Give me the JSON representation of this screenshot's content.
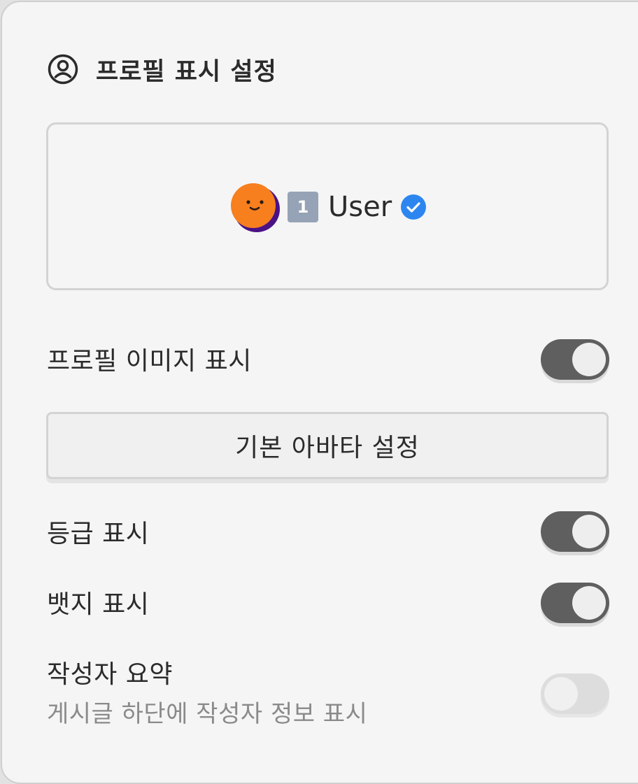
{
  "header": {
    "title": "프로필 표시 설정",
    "icon": "user-circle-icon"
  },
  "preview": {
    "level": "1",
    "username": "User",
    "avatar_icon": "smiley-moon-avatar",
    "verified_icon": "verified-check-icon",
    "colors": {
      "avatar_face": "#f77f1e",
      "avatar_shadow": "#4a1286",
      "level_badge": "#96a3b6",
      "verified": "#2d86f0"
    }
  },
  "settings": {
    "show_profile_image": {
      "label": "프로필 이미지 표시",
      "enabled": true
    },
    "default_avatar_button": {
      "label": "기본 아바타 설정"
    },
    "show_level": {
      "label": "등급 표시",
      "enabled": true
    },
    "show_badge": {
      "label": "뱃지 표시",
      "enabled": true
    },
    "author_summary": {
      "label": "작성자 요약",
      "description": "게시글 하단에 작성자 정보 표시",
      "enabled": false
    }
  },
  "colors": {
    "toggle_on": "#5f5f5f",
    "toggle_off": "#dddddd",
    "panel_bg": "#f5f5f5"
  }
}
